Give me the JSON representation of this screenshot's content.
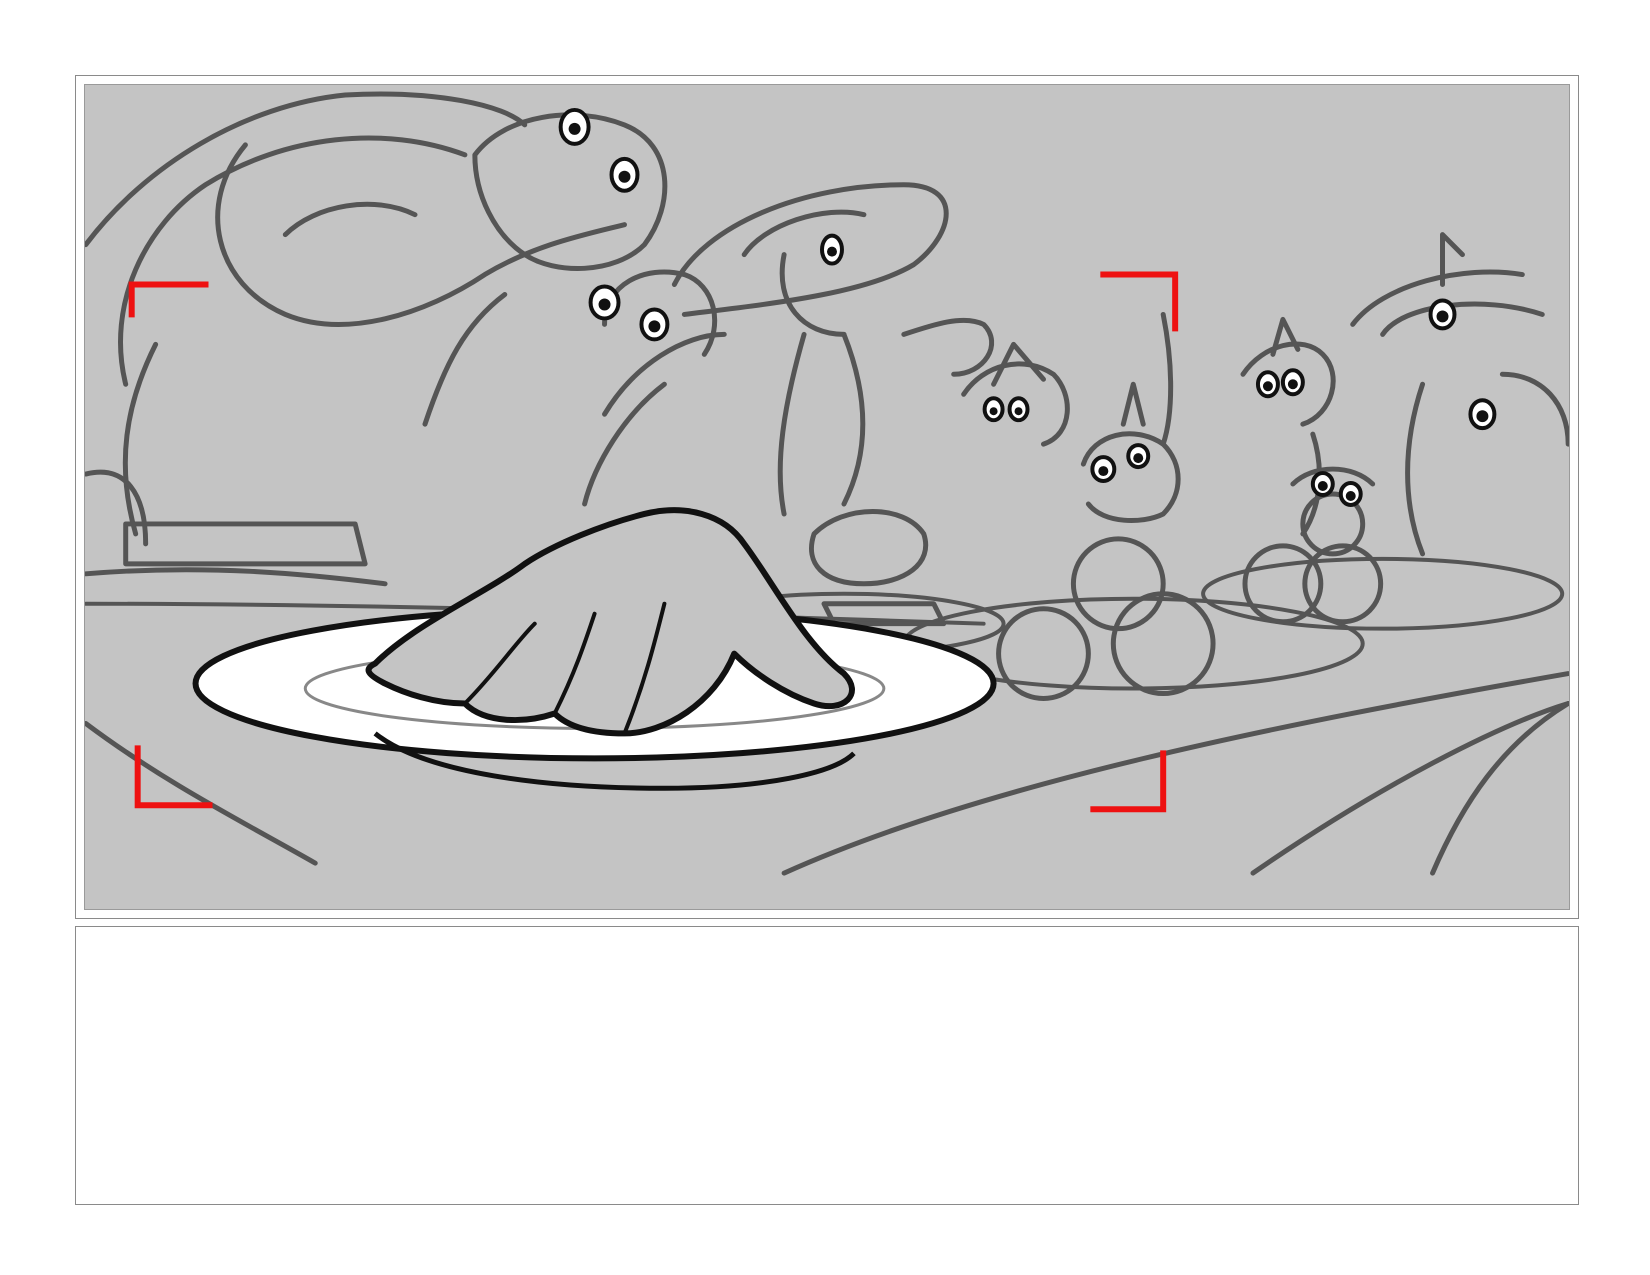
{
  "storyboard": {
    "panel": {
      "image_description_icon": "sketch-illustration",
      "background_color": "#c4c4c4",
      "sketch_color": "#555555",
      "safe_area_color": "#ee1111"
    },
    "notes": {
      "text": ""
    }
  }
}
